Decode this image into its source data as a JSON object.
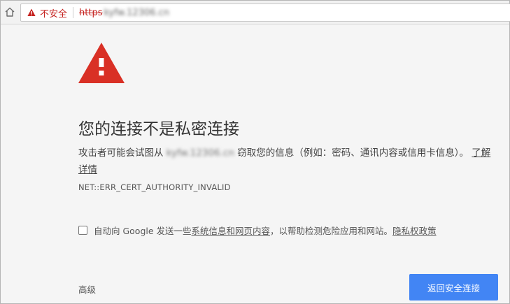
{
  "address_bar": {
    "security_label": "不安全",
    "scheme": "https",
    "host": "kyfw.12306.cn"
  },
  "icons": {
    "home": "home-icon",
    "omnibox_warning": "warning-triangle-icon",
    "main_warning": "warning-triangle-icon"
  },
  "interstitial": {
    "heading": "您的连接不是私密连接",
    "body_prefix": "攻击者可能会试图从",
    "body_host": "kyfw.12306.cn",
    "body_suffix": "窃取您的信息（例如：密码、通讯内容或信用卡信息）。",
    "learn_more": "了解详情",
    "error_code": "NET::ERR_CERT_AUTHORITY_INVALID",
    "report_prefix": "自动向 Google 发送一些",
    "report_link": "系统信息和网页内容",
    "report_suffix": "，以帮助检测危险应用和网站。",
    "privacy_link": "隐私权政策",
    "advanced_label": "高级",
    "back_button": "返回安全连接"
  },
  "colors": {
    "warning_red": "#d93025",
    "button_blue": "#4285f4"
  }
}
